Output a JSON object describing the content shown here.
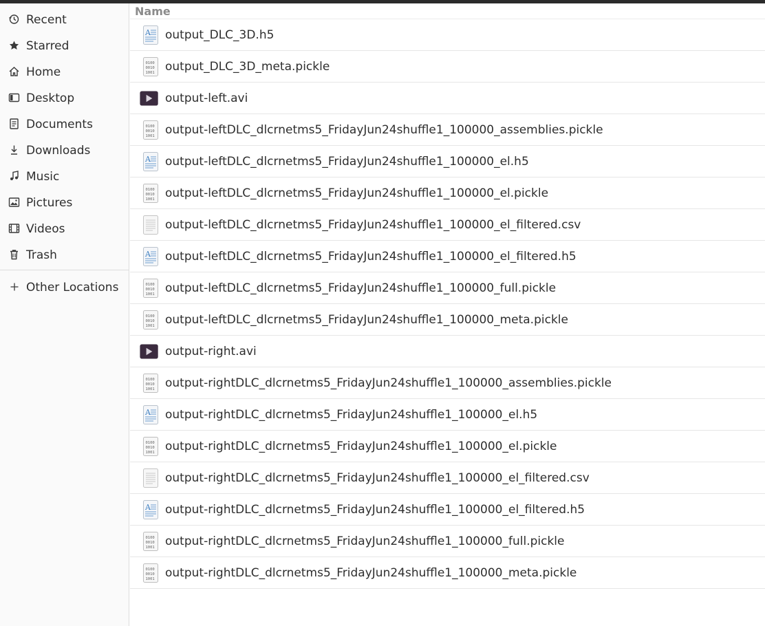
{
  "sidebar": {
    "items": [
      {
        "label": "Recent",
        "icon": "clock-icon"
      },
      {
        "label": "Starred",
        "icon": "star-icon"
      },
      {
        "label": "Home",
        "icon": "home-icon"
      },
      {
        "label": "Desktop",
        "icon": "desktop-icon"
      },
      {
        "label": "Documents",
        "icon": "documents-icon"
      },
      {
        "label": "Downloads",
        "icon": "download-icon"
      },
      {
        "label": "Music",
        "icon": "music-icon"
      },
      {
        "label": "Pictures",
        "icon": "pictures-icon"
      },
      {
        "label": "Videos",
        "icon": "videos-icon"
      },
      {
        "label": "Trash",
        "icon": "trash-icon"
      }
    ],
    "other_locations": {
      "label": "Other Locations",
      "icon": "plus-icon"
    }
  },
  "file_list": {
    "column_header": "Name",
    "files": [
      {
        "name": "output_DLC_3D.h5",
        "icon": "hdf5-document-icon"
      },
      {
        "name": "output_DLC_3D_meta.pickle",
        "icon": "binary-file-icon"
      },
      {
        "name": "output-left.avi",
        "icon": "video-file-icon"
      },
      {
        "name": "output-leftDLC_dlcrnetms5_FridayJun24shuffle1_100000_assemblies.pickle",
        "icon": "binary-file-icon"
      },
      {
        "name": "output-leftDLC_dlcrnetms5_FridayJun24shuffle1_100000_el.h5",
        "icon": "hdf5-document-icon"
      },
      {
        "name": "output-leftDLC_dlcrnetms5_FridayJun24shuffle1_100000_el.pickle",
        "icon": "binary-file-icon"
      },
      {
        "name": "output-leftDLC_dlcrnetms5_FridayJun24shuffle1_100000_el_filtered.csv",
        "icon": "text-file-icon"
      },
      {
        "name": "output-leftDLC_dlcrnetms5_FridayJun24shuffle1_100000_el_filtered.h5",
        "icon": "hdf5-document-icon"
      },
      {
        "name": "output-leftDLC_dlcrnetms5_FridayJun24shuffle1_100000_full.pickle",
        "icon": "binary-file-icon"
      },
      {
        "name": "output-leftDLC_dlcrnetms5_FridayJun24shuffle1_100000_meta.pickle",
        "icon": "binary-file-icon"
      },
      {
        "name": "output-right.avi",
        "icon": "video-file-icon"
      },
      {
        "name": "output-rightDLC_dlcrnetms5_FridayJun24shuffle1_100000_assemblies.pickle",
        "icon": "binary-file-icon"
      },
      {
        "name": "output-rightDLC_dlcrnetms5_FridayJun24shuffle1_100000_el.h5",
        "icon": "hdf5-document-icon"
      },
      {
        "name": "output-rightDLC_dlcrnetms5_FridayJun24shuffle1_100000_el.pickle",
        "icon": "binary-file-icon"
      },
      {
        "name": "output-rightDLC_dlcrnetms5_FridayJun24shuffle1_100000_el_filtered.csv",
        "icon": "text-file-icon"
      },
      {
        "name": "output-rightDLC_dlcrnetms5_FridayJun24shuffle1_100000_el_filtered.h5",
        "icon": "hdf5-document-icon"
      },
      {
        "name": "output-rightDLC_dlcrnetms5_FridayJun24shuffle1_100000_full.pickle",
        "icon": "binary-file-icon"
      },
      {
        "name": "output-rightDLC_dlcrnetms5_FridayJun24shuffle1_100000_meta.pickle",
        "icon": "binary-file-icon"
      }
    ]
  },
  "colors": {
    "sidebar_bg": "#fafafa",
    "video_icon_bg": "#3b2b3f",
    "header_text": "#8b8b8b",
    "hdf5_icon_accent": "#3d7fc1"
  }
}
